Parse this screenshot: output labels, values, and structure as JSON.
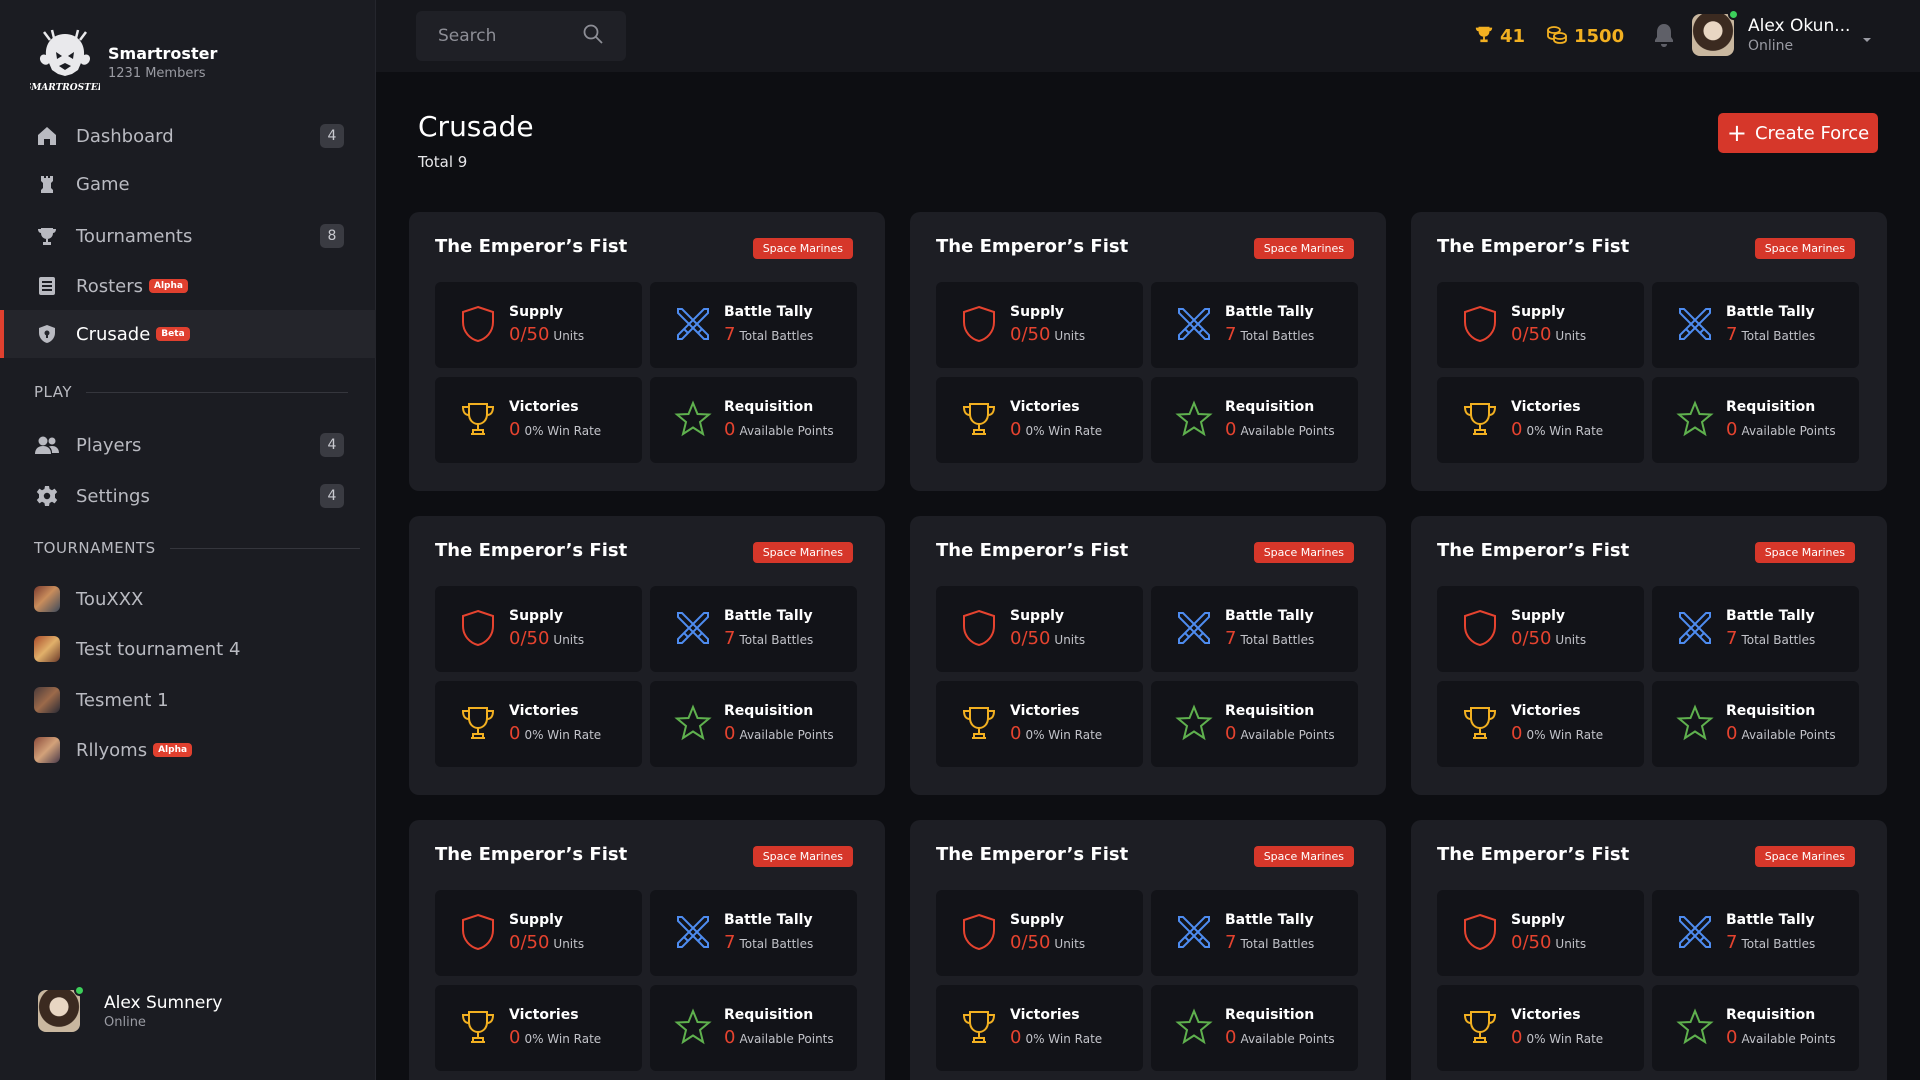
{
  "brand": {
    "name": "Smartroster",
    "members": "1231 Members",
    "logo_text": "SMARTROSTER"
  },
  "sidebar": {
    "items": [
      {
        "label": "Dashboard",
        "count": "4",
        "icon": "home-icon"
      },
      {
        "label": "Game",
        "icon": "chess-rook-icon"
      },
      {
        "label": "Tournaments",
        "count": "8",
        "icon": "trophy-icon"
      },
      {
        "label": "Rosters",
        "tag": "Alpha",
        "icon": "list-icon"
      },
      {
        "label": "Crusade",
        "tag": "Beta",
        "icon": "shield-icon",
        "active": true
      }
    ],
    "play_label": "PLAY",
    "play_items": [
      {
        "label": "Players",
        "count": "4",
        "icon": "users-icon"
      },
      {
        "label": "Settings",
        "count": "4",
        "icon": "gear-icon"
      }
    ],
    "tournaments_label": "TOURNAMENTS",
    "tournaments": [
      {
        "label": "TouXXX"
      },
      {
        "label": "Test tournament 4"
      },
      {
        "label": "Tesment 1"
      },
      {
        "label": "Rllyoms",
        "tag": "Alpha"
      }
    ],
    "user": {
      "name": "Alex Sumnery",
      "status": "Online"
    }
  },
  "header": {
    "search_placeholder": "Search",
    "trophies": "41",
    "coins": "1500",
    "user": {
      "name": "Alex Okun...",
      "status": "Online"
    }
  },
  "page": {
    "title": "Crusade",
    "total": "Total 9",
    "create_label": "Create Force"
  },
  "colors": {
    "accent": "#d6372a",
    "gold": "#f2b021",
    "blue": "#4e8cf0",
    "green": "#5fb14e"
  },
  "cards": [
    {
      "title": "The Emperor’s Fist",
      "faction": "Space Marines",
      "supply_label": "Supply",
      "supply_value": "0/50",
      "supply_unit": "Units",
      "battle_label": "Battle Tally",
      "battle_value": "7",
      "battle_unit": "Total Battles",
      "victories_label": "Victories",
      "victories_value": "0",
      "victories_unit": "0% Win Rate",
      "req_label": "Requisition",
      "req_value": "0",
      "req_unit": "Available Points"
    },
    {
      "title": "The Emperor’s Fist",
      "faction": "Space Marines",
      "supply_label": "Supply",
      "supply_value": "0/50",
      "supply_unit": "Units",
      "battle_label": "Battle Tally",
      "battle_value": "7",
      "battle_unit": "Total Battles",
      "victories_label": "Victories",
      "victories_value": "0",
      "victories_unit": "0% Win Rate",
      "req_label": "Requisition",
      "req_value": "0",
      "req_unit": "Available Points"
    },
    {
      "title": "The Emperor’s Fist",
      "faction": "Space Marines",
      "supply_label": "Supply",
      "supply_value": "0/50",
      "supply_unit": "Units",
      "battle_label": "Battle Tally",
      "battle_value": "7",
      "battle_unit": "Total Battles",
      "victories_label": "Victories",
      "victories_value": "0",
      "victories_unit": "0% Win Rate",
      "req_label": "Requisition",
      "req_value": "0",
      "req_unit": "Available Points"
    },
    {
      "title": "The Emperor’s Fist",
      "faction": "Space Marines",
      "supply_label": "Supply",
      "supply_value": "0/50",
      "supply_unit": "Units",
      "battle_label": "Battle Tally",
      "battle_value": "7",
      "battle_unit": "Total Battles",
      "victories_label": "Victories",
      "victories_value": "0",
      "victories_unit": "0% Win Rate",
      "req_label": "Requisition",
      "req_value": "0",
      "req_unit": "Available Points"
    },
    {
      "title": "The Emperor’s Fist",
      "faction": "Space Marines",
      "supply_label": "Supply",
      "supply_value": "0/50",
      "supply_unit": "Units",
      "battle_label": "Battle Tally",
      "battle_value": "7",
      "battle_unit": "Total Battles",
      "victories_label": "Victories",
      "victories_value": "0",
      "victories_unit": "0% Win Rate",
      "req_label": "Requisition",
      "req_value": "0",
      "req_unit": "Available Points"
    },
    {
      "title": "The Emperor’s Fist",
      "faction": "Space Marines",
      "supply_label": "Supply",
      "supply_value": "0/50",
      "supply_unit": "Units",
      "battle_label": "Battle Tally",
      "battle_value": "7",
      "battle_unit": "Total Battles",
      "victories_label": "Victories",
      "victories_value": "0",
      "victories_unit": "0% Win Rate",
      "req_label": "Requisition",
      "req_value": "0",
      "req_unit": "Available Points"
    },
    {
      "title": "The Emperor’s Fist",
      "faction": "Space Marines",
      "supply_label": "Supply",
      "supply_value": "0/50",
      "supply_unit": "Units",
      "battle_label": "Battle Tally",
      "battle_value": "7",
      "battle_unit": "Total Battles",
      "victories_label": "Victories",
      "victories_value": "0",
      "victories_unit": "0% Win Rate",
      "req_label": "Requisition",
      "req_value": "0",
      "req_unit": "Available Points"
    },
    {
      "title": "The Emperor’s Fist",
      "faction": "Space Marines",
      "supply_label": "Supply",
      "supply_value": "0/50",
      "supply_unit": "Units",
      "battle_label": "Battle Tally",
      "battle_value": "7",
      "battle_unit": "Total Battles",
      "victories_label": "Victories",
      "victories_value": "0",
      "victories_unit": "0% Win Rate",
      "req_label": "Requisition",
      "req_value": "0",
      "req_unit": "Available Points"
    },
    {
      "title": "The Emperor’s Fist",
      "faction": "Space Marines",
      "supply_label": "Supply",
      "supply_value": "0/50",
      "supply_unit": "Units",
      "battle_label": "Battle Tally",
      "battle_value": "7",
      "battle_unit": "Total Battles",
      "victories_label": "Victories",
      "victories_value": "0",
      "victories_unit": "0% Win Rate",
      "req_label": "Requisition",
      "req_value": "0",
      "req_unit": "Available Points"
    }
  ]
}
